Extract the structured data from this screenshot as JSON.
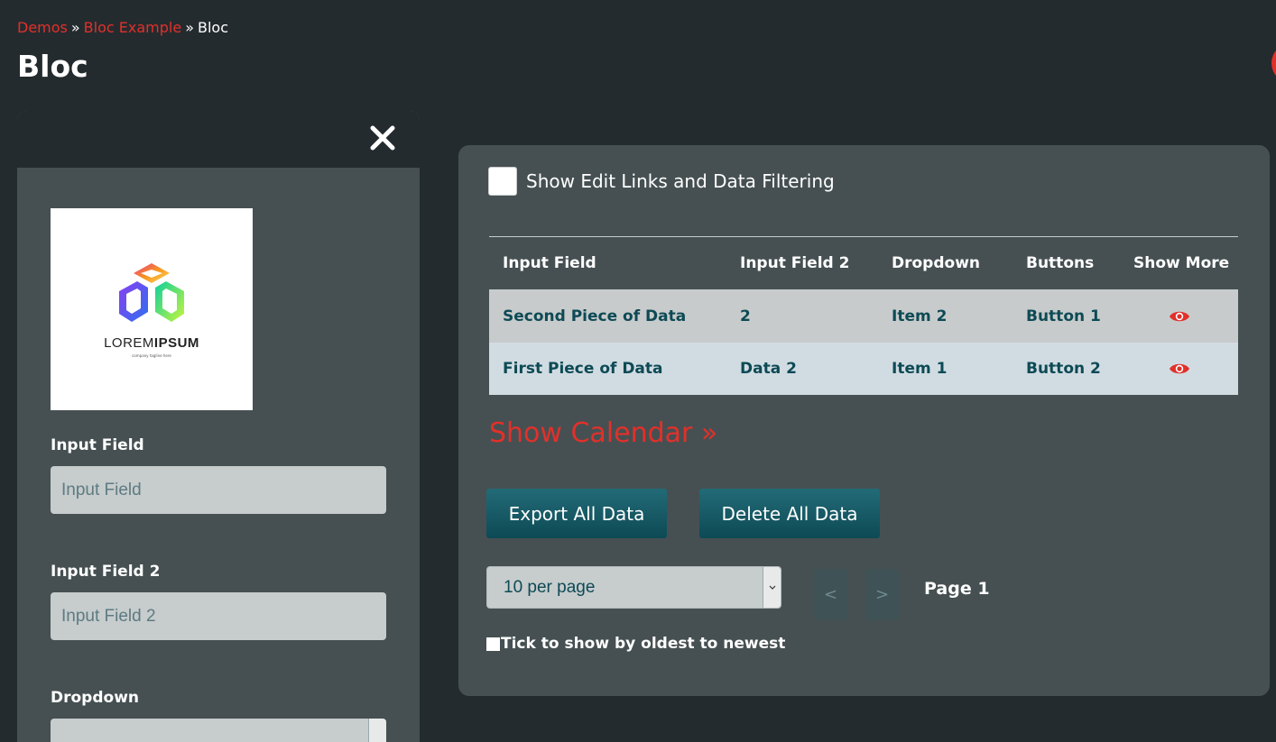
{
  "breadcrumb": {
    "items": [
      "Demos",
      "Bloc Example"
    ],
    "current": "Bloc",
    "separator": "»"
  },
  "page_title": "Bloc",
  "form": {
    "logo": {
      "word1": "LOREM",
      "word2": "IPSUM",
      "tagline": "company tagline here"
    },
    "fields": [
      {
        "label": "Input Field",
        "placeholder": "Input Field"
      },
      {
        "label": "Input Field 2",
        "placeholder": "Input Field 2"
      },
      {
        "label": "Dropdown"
      }
    ]
  },
  "toolbar": {
    "edit_toggle_label": "Show Edit Links and Data Filtering"
  },
  "table": {
    "headers": [
      "Input Field",
      "Input Field 2",
      "Dropdown",
      "Buttons",
      "Show More"
    ],
    "rows": [
      [
        "Second Piece of Data",
        "2",
        "Item 2",
        "Button 1"
      ],
      [
        "First Piece of Data",
        "Data 2",
        "Item 1",
        "Button 2"
      ]
    ]
  },
  "show_calendar": "Show Calendar »",
  "actions": {
    "export": "Export All Data",
    "delete": "Delete All Data"
  },
  "pagination": {
    "per_page": "10 per page",
    "prev": "<",
    "next": ">",
    "page": "Page 1"
  },
  "order_toggle_label": "Tick to show by oldest to newest",
  "colors": {
    "accent": "#e2302a",
    "background": "#242b2f",
    "panel": "#465052",
    "table_text": "#0d4a55",
    "button": "#226b77"
  },
  "icons": [
    "close-icon",
    "eye-icon",
    "chevron-down-icon"
  ]
}
